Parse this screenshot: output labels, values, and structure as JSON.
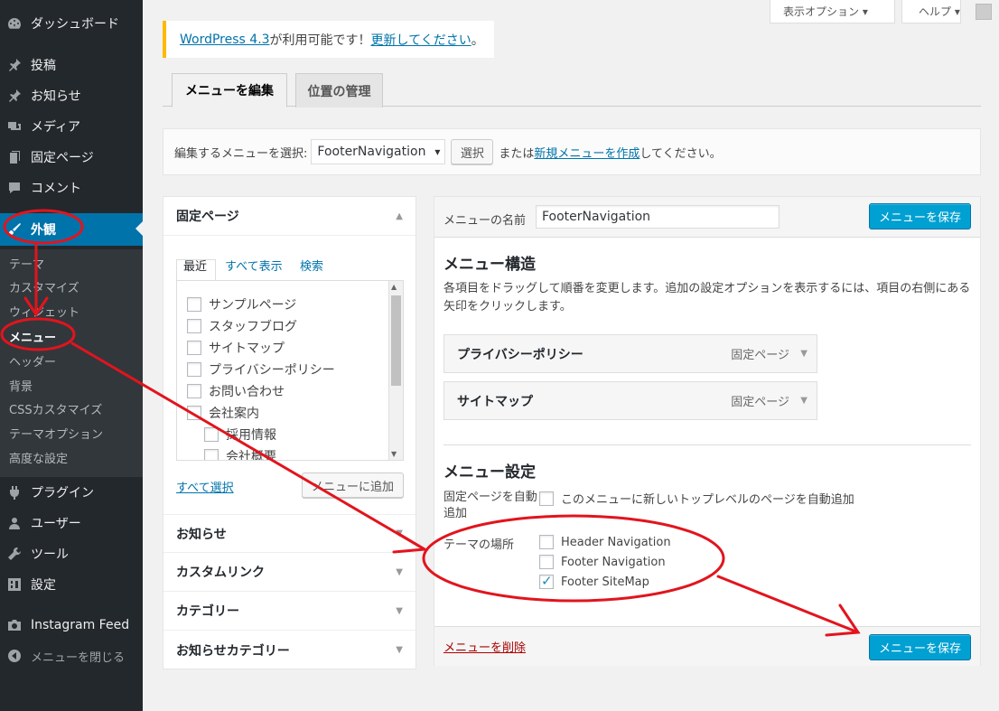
{
  "sidebar": {
    "items": [
      {
        "label": "ダッシュボード",
        "icon": "dashboard-icon"
      },
      {
        "label": "投稿",
        "icon": "pin-icon"
      },
      {
        "label": "お知らせ",
        "icon": "pin-icon"
      },
      {
        "label": "メディア",
        "icon": "media-icon"
      },
      {
        "label": "固定ページ",
        "icon": "page-icon"
      },
      {
        "label": "コメント",
        "icon": "comment-icon"
      },
      {
        "label": "外観",
        "icon": "brush-icon"
      }
    ],
    "submenu": [
      "テーマ",
      "カスタマイズ",
      "ウィジェット",
      "メニュー",
      "ヘッダー",
      "背景",
      "CSSカスタマイズ",
      "テーマオプション",
      "高度な設定"
    ],
    "items2": [
      {
        "label": "プラグイン",
        "icon": "plugin-icon"
      },
      {
        "label": "ユーザー",
        "icon": "user-icon"
      },
      {
        "label": "ツール",
        "icon": "wrench-icon"
      },
      {
        "label": "設定",
        "icon": "settings-icon"
      },
      {
        "label": "Instagram Feed",
        "icon": "camera-icon"
      }
    ],
    "collapse": "メニューを閉じる"
  },
  "topbar": {
    "screen_options": "表示オプション ▾",
    "help": "ヘルプ ▾"
  },
  "notice": {
    "link1": "WordPress 4.3",
    "text1": " が利用可能です！",
    "link2": "更新してください",
    "text2": "。"
  },
  "tabs": [
    "メニューを編集",
    "位置の管理"
  ],
  "select_bar": {
    "label": "編集するメニューを選択:",
    "value": "FooterNavigation",
    "button": "選択",
    "or": " または",
    "link": "新規メニューを作成",
    "tail": "してください。"
  },
  "left": {
    "section": "固定ページ",
    "ptabs": [
      "最近",
      "すべて表示",
      "検索"
    ],
    "pages": [
      "サンプルページ",
      "スタッフブログ",
      "サイトマップ",
      "プライバシーポリシー",
      "お問い合わせ",
      "会社案内",
      "採用情報",
      "会社概要"
    ],
    "select_all": "すべて選択",
    "add_button": "メニューに追加",
    "collapsed": [
      "お知らせ",
      "カスタムリンク",
      "カテゴリー",
      "お知らせカテゴリー"
    ]
  },
  "right": {
    "name_label": "メニューの名前",
    "name_value": "FooterNavigation",
    "save": "メニューを保存",
    "structure_title": "メニュー構造",
    "structure_desc": "各項目をドラッグして順番を変更します。追加の設定オプションを表示するには、項目の右側にある矢印をクリックします。",
    "items": [
      {
        "label": "プライバシーポリシー",
        "type": "固定ページ"
      },
      {
        "label": "サイトマップ",
        "type": "固定ページ"
      }
    ],
    "settings_title": "メニュー設定",
    "auto_label": "固定ページを自動追加",
    "auto_text": "このメニューに新しいトップレベルのページを自動追加",
    "locations_label": "テーマの場所",
    "locations": [
      {
        "label": "Header Navigation",
        "checked": false
      },
      {
        "label": "Footer Navigation",
        "checked": false
      },
      {
        "label": "Footer SiteMap",
        "checked": true
      }
    ],
    "delete": "メニューを削除"
  },
  "annotation_color": "#e2141d"
}
